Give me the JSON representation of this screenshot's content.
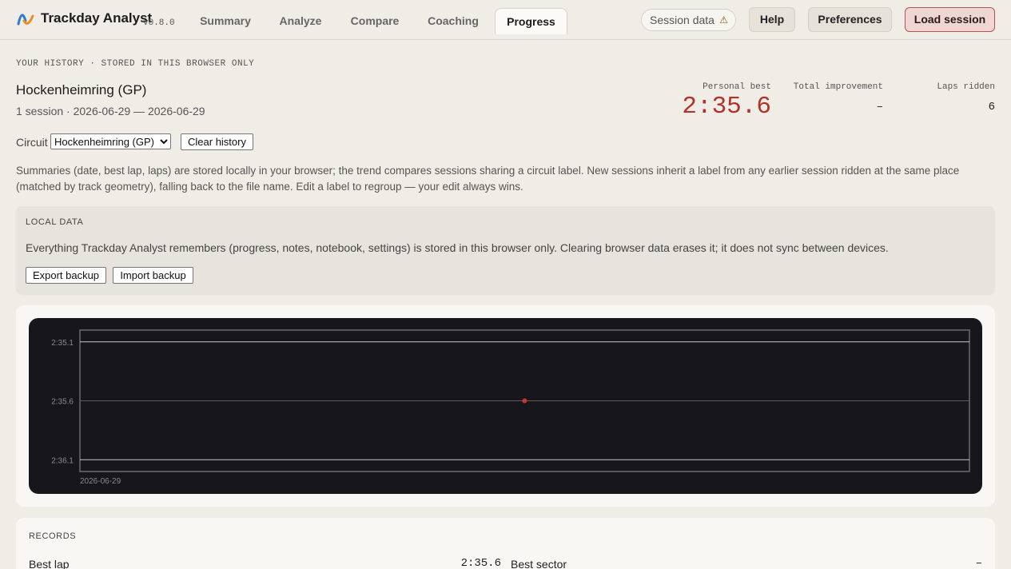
{
  "app": {
    "name": "Trackday Analyst",
    "version": "v0.8.0"
  },
  "nav": {
    "tabs": [
      {
        "label": "Summary"
      },
      {
        "label": "Analyze"
      },
      {
        "label": "Compare"
      },
      {
        "label": "Coaching"
      },
      {
        "label": "Progress",
        "active": true
      }
    ]
  },
  "header": {
    "session_pill": "Session data",
    "warning_icon": "warning-triangle-icon",
    "help_label": "Help",
    "preferences_label": "Preferences",
    "load_label": "Load session"
  },
  "history": {
    "kicker": "YOUR HISTORY · STORED IN THIS BROWSER ONLY",
    "circuit_name": "Hockenheimring (GP)",
    "subtitle": "1 session · 2026-06-29 — 2026-06-29",
    "stats": {
      "personal_best_label": "Personal best",
      "personal_best_value": "2:35.6",
      "total_improvement_label": "Total improvement",
      "total_improvement_value": "–",
      "laps_label": "Laps ridden",
      "laps_value": "6"
    },
    "circuit_label": "Circuit",
    "circuit_selected": "Hockenheimring (GP)",
    "clear_label": "Clear history",
    "description": "Summaries (date, best lap, laps) are stored locally in your browser; the trend compares sessions sharing a circuit label. New sessions inherit a label from any earlier session ridden at the same place (matched by track geometry), falling back to the file name. Edit a label to regroup — your edit always wins."
  },
  "local_data": {
    "heading": "LOCAL DATA",
    "text": "Everything Trackday Analyst remembers (progress, notes, notebook, settings) is stored in this browser only. Clearing browser data erases it; it does not sync between devices.",
    "export_label": "Export backup",
    "import_label": "Import backup"
  },
  "chart_data": {
    "type": "scatter",
    "x": [
      "2026-06-29"
    ],
    "y": [
      155.6
    ],
    "y_tick_labels": [
      "2:35.1",
      "2:35.6",
      "2:36.1"
    ],
    "y_ticks": [
      155.1,
      155.6,
      156.1
    ],
    "ylim": [
      155.0,
      156.2
    ],
    "y_inverted": true,
    "x_tick_labels": [
      "2026-06-29"
    ],
    "grid": true,
    "point_color": "#c0392b",
    "background": "#16161b"
  },
  "records": {
    "heading": "RECORDS",
    "best_lap_label": "Best lap",
    "best_lap_value": "2:35.6",
    "best_sector_label": "Best sector",
    "best_sector_value": "–"
  }
}
